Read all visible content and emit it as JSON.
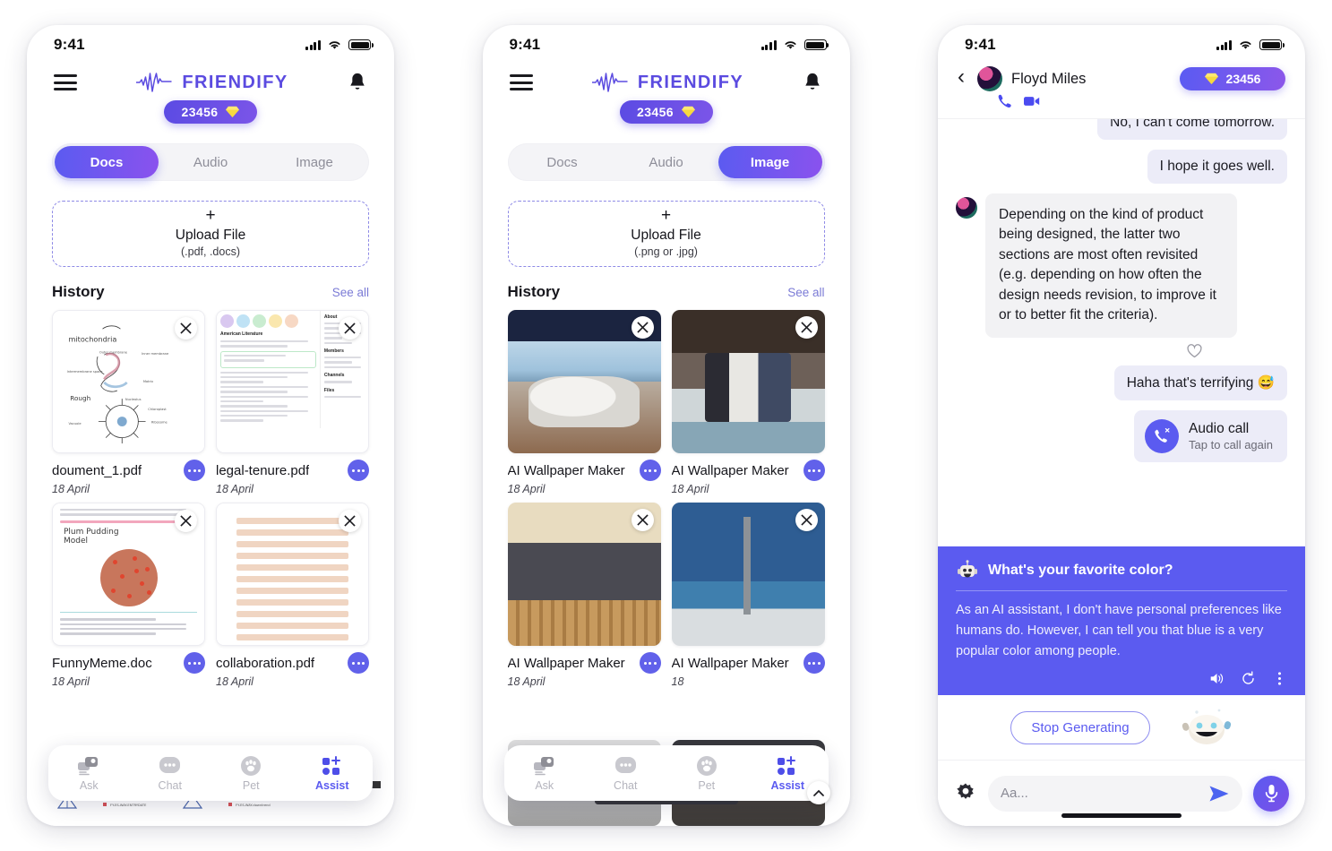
{
  "theme": {
    "accent": "#5b5bf0",
    "accent_2": "#8a52ee",
    "gem_yellow": "#f5d33c",
    "muted": "#8e8e99"
  },
  "status_bar": {
    "time": "9:41",
    "signal_icon": "signal-bars-icon",
    "wifi_icon": "wifi-icon",
    "battery_icon": "battery-icon"
  },
  "phone1": {
    "menu_icon": "hamburger-menu-icon",
    "brand": "FRIENDIFY",
    "brand_wave_icon": "waveform-icon",
    "bell_icon": "bell-icon",
    "gem_count": "23456",
    "gem_icon": "gem-icon",
    "tabs": [
      {
        "label": "Docs",
        "active": true
      },
      {
        "label": "Audio",
        "active": false
      },
      {
        "label": "Image",
        "active": false
      }
    ],
    "upload": {
      "plus": "+",
      "title": "Upload File",
      "subtitle": "(.pdf, .docs)"
    },
    "history": {
      "title": "History",
      "see_all": "See all"
    },
    "cards": [
      {
        "name": "doument_1.pdf",
        "date": "18 April"
      },
      {
        "name": "legal-tenure.pdf",
        "date": "18 April"
      },
      {
        "name": "FunnyMeme.doc",
        "date": "18 April"
      },
      {
        "name": "collaboration.pdf",
        "date": "18 April"
      }
    ],
    "nav": [
      {
        "label": "Ask",
        "icon": "ask-chat-bubbles-icon",
        "active": false
      },
      {
        "label": "Chat",
        "icon": "chat-bubble-icon",
        "active": false
      },
      {
        "label": "Pet",
        "icon": "paw-icon",
        "active": false
      },
      {
        "label": "Assist",
        "icon": "assist-grid-plus-icon",
        "active": true
      }
    ]
  },
  "phone2": {
    "menu_icon": "hamburger-menu-icon",
    "brand": "FRIENDIFY",
    "bell_icon": "bell-icon",
    "gem_count": "23456",
    "tabs": [
      {
        "label": "Docs",
        "active": false
      },
      {
        "label": "Audio",
        "active": false
      },
      {
        "label": "Image",
        "active": true
      }
    ],
    "upload": {
      "plus": "+",
      "title": "Upload File",
      "subtitle": "(.png or .jpg)"
    },
    "history": {
      "title": "History",
      "see_all": "See all"
    },
    "cards": [
      {
        "name": "AI Wallpaper Maker",
        "date": "18 April"
      },
      {
        "name": "AI Wallpaper Maker",
        "date": "18 April"
      },
      {
        "name": "AI Wallpaper Maker",
        "date": "18 April"
      },
      {
        "name": "AI Wallpaper Maker",
        "date": "18"
      }
    ],
    "nav": [
      {
        "label": "Ask",
        "icon": "ask-chat-bubbles-icon",
        "active": false
      },
      {
        "label": "Chat",
        "icon": "chat-bubble-icon",
        "active": false
      },
      {
        "label": "Pet",
        "icon": "paw-icon",
        "active": false
      },
      {
        "label": "Assist",
        "icon": "assist-grid-plus-icon",
        "active": true
      }
    ]
  },
  "phone3": {
    "back_icon": "back-chevron-icon",
    "avatar": "contact-avatar",
    "contact_name": "Floyd Miles",
    "phone_icon": "phone-call-icon",
    "video_icon": "video-camera-icon",
    "gem_count": "23456",
    "gem_icon": "gem-icon",
    "messages": [
      {
        "side": "out",
        "text": "No, I can't come tomorrow."
      },
      {
        "side": "out",
        "text": "I hope it goes well."
      },
      {
        "side": "in",
        "text": "Depending on the kind of product being designed, the latter two sections are most often revisited (e.g. depending on how often the design needs revision, to improve it or to better fit the criteria)."
      },
      {
        "side": "out",
        "text": "Haha that's terrifying 😅"
      }
    ],
    "heart_icon": "heart-outline-icon",
    "call_card": {
      "icon": "missed-call-icon",
      "title": "Audio call",
      "subtitle": "Tap to call again"
    },
    "ai_panel": {
      "robot_icon": "robot-avatar-icon",
      "question": "What's your favorite color?",
      "answer": "As an AI assistant, I don't have personal preferences like humans do. However, I can tell you that blue is a very popular color among people.",
      "tools": [
        {
          "icon": "speaker-volume-icon"
        },
        {
          "icon": "regenerate-icon"
        },
        {
          "icon": "more-vertical-icon"
        }
      ]
    },
    "stop_button": "Stop Generating",
    "robot_mascot_icon": "robot-mascot-icon",
    "composer": {
      "settings_icon": "gear-icon",
      "input_value": "",
      "input_placeholder": "Aa...",
      "send_icon": "send-paper-plane-icon",
      "mic_icon": "microphone-icon"
    }
  }
}
